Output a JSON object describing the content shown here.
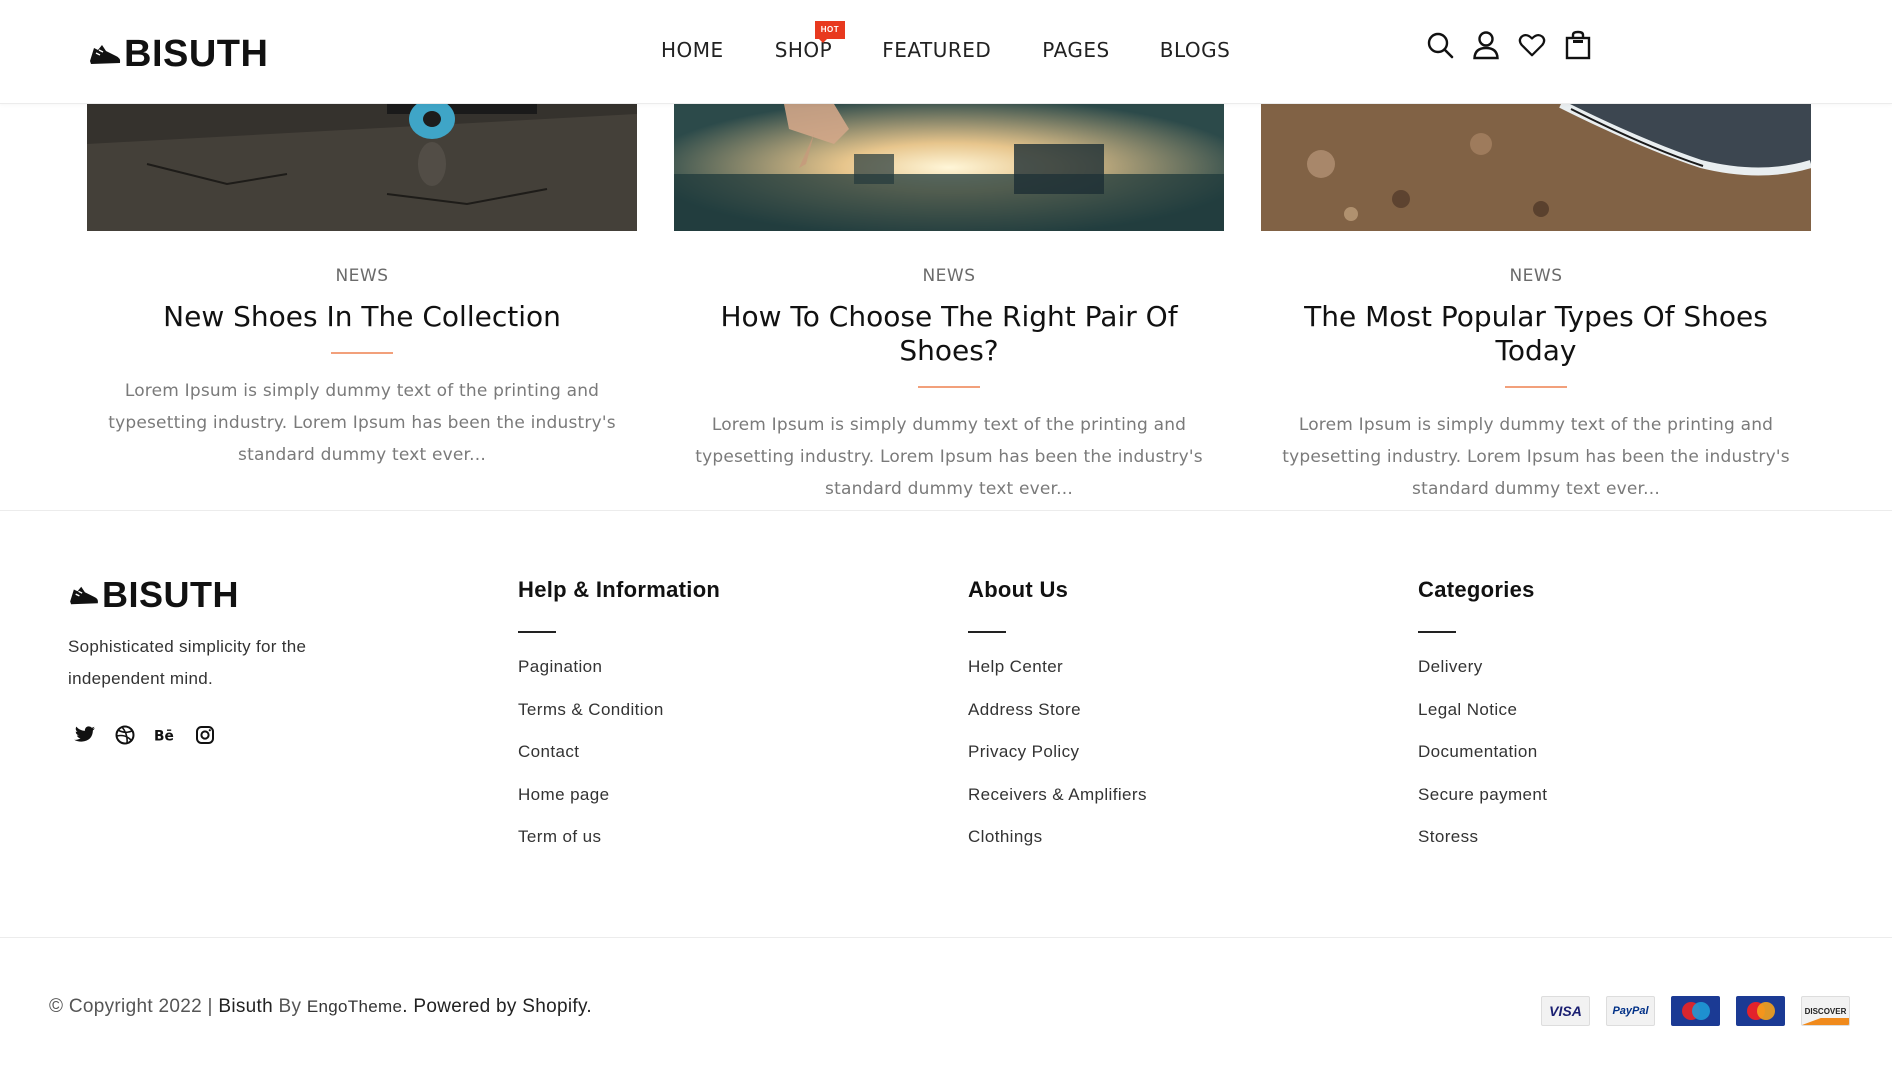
{
  "brand": {
    "name": "BISUTH"
  },
  "nav": {
    "items": [
      {
        "label": "HOME"
      },
      {
        "label": "SHOP",
        "badge": "HOT"
      },
      {
        "label": "FEATURED"
      },
      {
        "label": "PAGES"
      },
      {
        "label": "BLOGS"
      }
    ]
  },
  "header_icons": [
    "search-icon",
    "account-icon",
    "wishlist-heart-icon",
    "cart-bag-icon"
  ],
  "posts": [
    {
      "category": "NEWS",
      "title": "New Shoes In The Collection",
      "excerpt": "Lorem Ipsum is simply dummy text of the printing and typesetting industry. Lorem Ipsum has been the industry's standard dummy text ever..."
    },
    {
      "category": "NEWS",
      "title": "How To Choose The Right Pair Of Shoes?",
      "excerpt": "Lorem Ipsum is simply dummy text of the printing and typesetting industry. Lorem Ipsum has been the industry's standard dummy text ever..."
    },
    {
      "category": "NEWS",
      "title": "The Most Popular Types Of Shoes Today",
      "excerpt": "Lorem Ipsum is simply dummy text of the printing and typesetting industry. Lorem Ipsum has been the industry's standard dummy text ever..."
    }
  ],
  "footer": {
    "tagline": "Sophisticated simplicity for the independent mind.",
    "socials": [
      "twitter-icon",
      "dribbble-icon",
      "behance-icon",
      "instagram-icon"
    ],
    "columns": [
      {
        "heading": "Help & Information",
        "links": [
          "Pagination",
          "Terms & Condition",
          "Contact",
          "Home page",
          "Term of us"
        ]
      },
      {
        "heading": "About Us",
        "links": [
          "Help Center",
          "Address Store",
          "Privacy Policy",
          "Receivers & Amplifiers",
          "Clothings"
        ]
      },
      {
        "heading": "Categories",
        "links": [
          "Delivery",
          "Legal Notice",
          "Documentation",
          "Secure payment",
          "Storess"
        ]
      }
    ],
    "copyright": {
      "prefix": "© Copyright 2022 | ",
      "brand": "Bisuth",
      "by": " By ",
      "author": "EngoTheme",
      "suffix": ". Powered by Shopify."
    },
    "payments": [
      {
        "label": "VISA"
      },
      {
        "label": "PayPal"
      },
      {
        "label": "Maestro"
      },
      {
        "label": "MasterCard"
      },
      {
        "label": "DISCOVER"
      }
    ]
  },
  "colors": {
    "accent_rule": "#f2a07b",
    "hot_badge": "#e8391f",
    "text_dark": "#111111",
    "text_muted": "#7a7a7a"
  }
}
